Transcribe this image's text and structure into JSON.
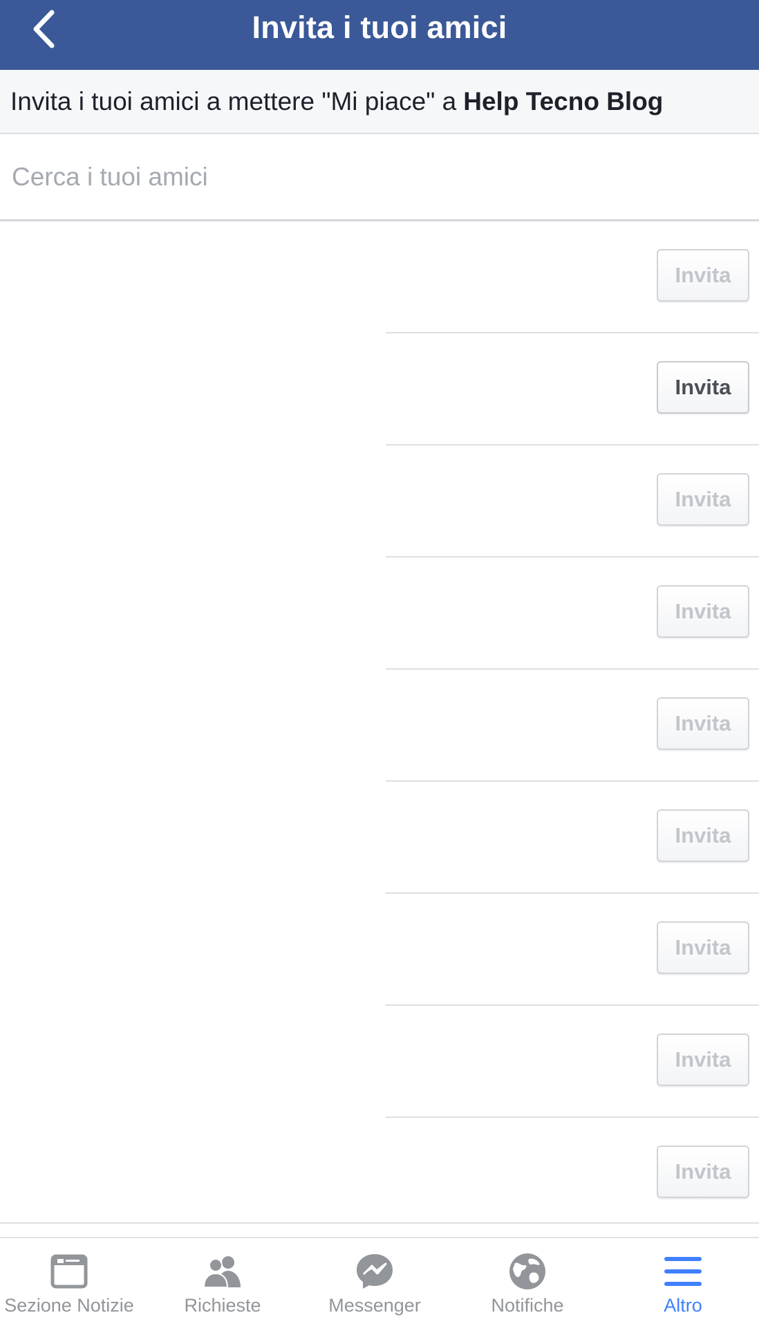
{
  "header": {
    "title": "Invita i tuoi amici",
    "back_icon": "chevron-left-icon",
    "color": "#3b5998"
  },
  "subheader": {
    "text": "Invita i tuoi amici a mettere \"Mi piace\" a",
    "page_name": "Help Tecno Blog"
  },
  "search": {
    "placeholder": "Cerca i tuoi amici",
    "value": ""
  },
  "friends": [
    {
      "button": "Invita",
      "state": "disabled"
    },
    {
      "button": "Invita",
      "state": "enabled"
    },
    {
      "button": "Invita",
      "state": "disabled"
    },
    {
      "button": "Invita",
      "state": "disabled"
    },
    {
      "button": "Invita",
      "state": "disabled"
    },
    {
      "button": "Invita",
      "state": "disabled"
    },
    {
      "button": "Invita",
      "state": "disabled"
    },
    {
      "button": "Invita",
      "state": "disabled"
    },
    {
      "button": "Invita",
      "state": "disabled"
    }
  ],
  "tabbar": {
    "active_color": "#4080ff",
    "inactive_color": "#929599",
    "items": [
      {
        "label": "Sezione Notizie",
        "icon": "news-feed-icon",
        "active": false
      },
      {
        "label": "Richieste",
        "icon": "friend-requests-icon",
        "active": false
      },
      {
        "label": "Messenger",
        "icon": "messenger-icon",
        "active": false
      },
      {
        "label": "Notifiche",
        "icon": "globe-notifications-icon",
        "active": false
      },
      {
        "label": "Altro",
        "icon": "menu-icon",
        "active": true
      }
    ]
  }
}
